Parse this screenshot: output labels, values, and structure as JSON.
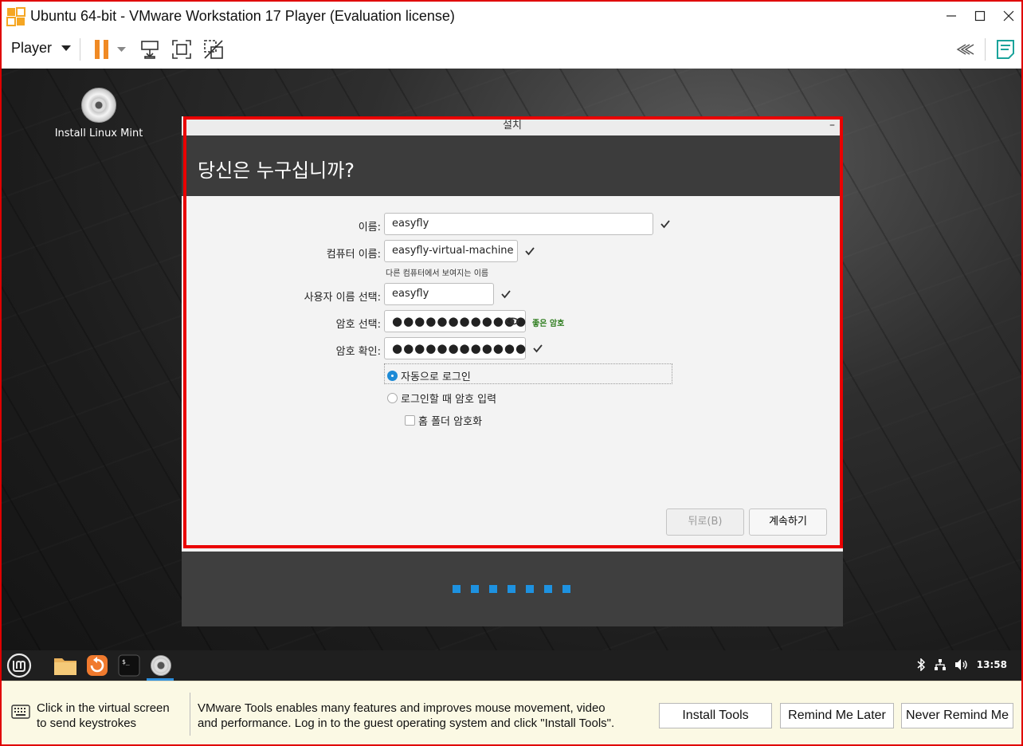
{
  "window": {
    "title": "Ubuntu 64-bit - VMware Workstation 17 Player (Evaluation license)"
  },
  "toolbar": {
    "player_label": "Player"
  },
  "desktop": {
    "icon_label": "Install Linux Mint"
  },
  "installer": {
    "window_title": "설치",
    "minimize_glyph": "–",
    "heading": "당신은 누구십니까?",
    "name_label": "이름:",
    "name_value": "easyfly",
    "computer_label": "컴퓨터 이름:",
    "computer_value": "easyfly-virtual-machine",
    "computer_hint": "다른 컴퓨터에서 보여지는 이름",
    "username_label": "사용자 이름 선택:",
    "username_value": "easyfly",
    "password_label": "암호 선택:",
    "password_value": "●●●●●●●●●●●●",
    "password_strength": "좋은 암호",
    "confirm_label": "암호 확인:",
    "confirm_value": "●●●●●●●●●●●●",
    "auto_login_label": "자동으로 로그인",
    "require_password_label": "로그인할 때 암호 입력",
    "encrypt_home_label": "홈 폴더 암호화",
    "back_button": "뒤로(B)",
    "continue_button": "계속하기",
    "progress_steps": 7
  },
  "taskbar": {
    "clock": "13:58"
  },
  "notification": {
    "hint_line1": "Click in the virtual screen",
    "hint_line2": "to send keystrokes",
    "message_line1": "VMware Tools enables many features and improves mouse movement, video",
    "message_line2": "and performance. Log in to the guest operating system and click \"Install Tools\".",
    "install_button": "Install Tools",
    "remind_later_button": "Remind Me Later",
    "never_remind_button": "Never Remind Me"
  },
  "colors": {
    "highlight_border": "#ea0000",
    "accent_blue": "#1e92e0",
    "pause_orange": "#f08a24",
    "good_password_green": "#2f7d1f",
    "notification_bg": "#fbf9e4"
  },
  "icons": [
    "vmware-logo-icon",
    "minimize-icon",
    "maximize-icon",
    "close-icon",
    "pause-icon",
    "send-ctrl-alt-del-icon",
    "fullscreen-icon",
    "unity-icon",
    "collapse-icon",
    "notes-icon",
    "disc-icon",
    "checkmark-icon",
    "eye-icon",
    "mint-menu-icon",
    "folder-icon",
    "update-manager-icon",
    "terminal-icon",
    "bluetooth-icon",
    "network-icon",
    "volume-icon",
    "keyboard-icon"
  ]
}
